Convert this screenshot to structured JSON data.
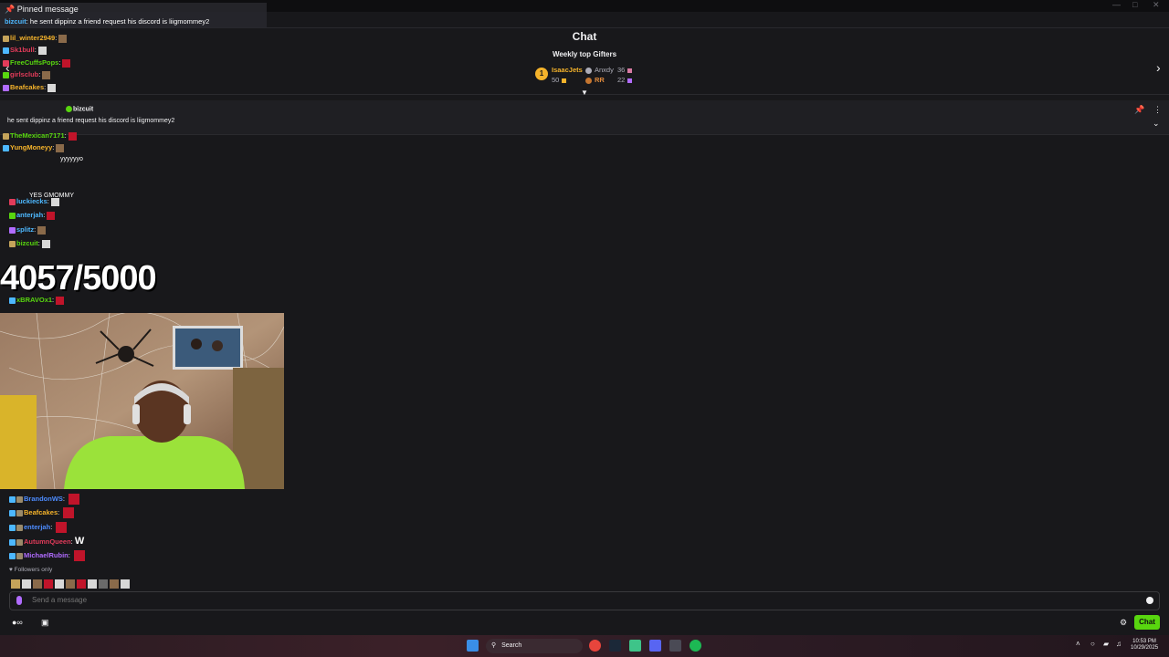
{
  "pinned_overlay": {
    "title": "Pinned message",
    "author": "bizcuit",
    "text": "he sent dippinz a friend request his discord is liigmommey2"
  },
  "overlay_chat": [
    {
      "user": "lil_winter2949",
      "color": "#f5b32b",
      "msg": ""
    },
    {
      "user": "Sk1bull",
      "color": "#e23b5a",
      "msg": ""
    },
    {
      "user": "FreeCuffsPops",
      "color": "#58d60f",
      "msg": ""
    },
    {
      "user": "girlsclub",
      "color": "#e23b5a",
      "msg": ""
    },
    {
      "user": "Beafcakes",
      "color": "#f5b32b",
      "msg": ""
    },
    {
      "user": "TheMexican7171",
      "color": "#58d60f",
      "msg": ""
    },
    {
      "user": "YungMoneyy",
      "color": "#f5b32b",
      "msg": ""
    },
    {
      "user": "luckiecks",
      "color": "#4db8ff",
      "msg": ""
    },
    {
      "user": "anterjah",
      "color": "#4db8ff",
      "msg": ""
    },
    {
      "user": "splitz",
      "color": "#4db8ff",
      "msg": ""
    },
    {
      "user": "bizcuit",
      "color": "#58d60f",
      "msg": ""
    },
    {
      "user": "xBRAVOx1",
      "color": "#58d60f",
      "msg": ""
    }
  ],
  "overlay_extra": {
    "yes_msg": "YES GMOMMY",
    "yo_msg": "yyyyyyo"
  },
  "goal_counter": "4057/5000",
  "lower_chat": [
    {
      "user": "BrandonWS",
      "color": "#4d8cff",
      "msg": ""
    },
    {
      "user": "Beafcakes",
      "color": "#f5b32b",
      "msg": ""
    },
    {
      "user": "enterjah",
      "color": "#4d8cff",
      "msg": ""
    },
    {
      "user": "AutumnQueen",
      "color": "#e23b5a",
      "msg": "W"
    },
    {
      "user": "MichaelRubin",
      "color": "#b16cff",
      "msg": ""
    }
  ],
  "followers_only": "Followers only",
  "chat_header": "Chat",
  "gifters": {
    "title": "Weekly top Gifters",
    "first": {
      "rank": "1",
      "name": "IsaacJets",
      "amount": "50"
    },
    "second": {
      "name": "Anxdy",
      "amount": "36"
    },
    "third": {
      "name": "RR",
      "amount": "22"
    }
  },
  "pinned_bar": {
    "author": "bizcuit",
    "text": "he sent dippinz a friend request his discord is liigmommey2"
  },
  "composer": {
    "placeholder": "Send a message",
    "chat_button": "Chat"
  },
  "taskbar": {
    "search": "Search",
    "time": "10:53 PM",
    "date": "10/29/2025"
  },
  "colors": {
    "accent": "#58d60f",
    "background": "#18181b",
    "gold": "#f5b32b"
  }
}
